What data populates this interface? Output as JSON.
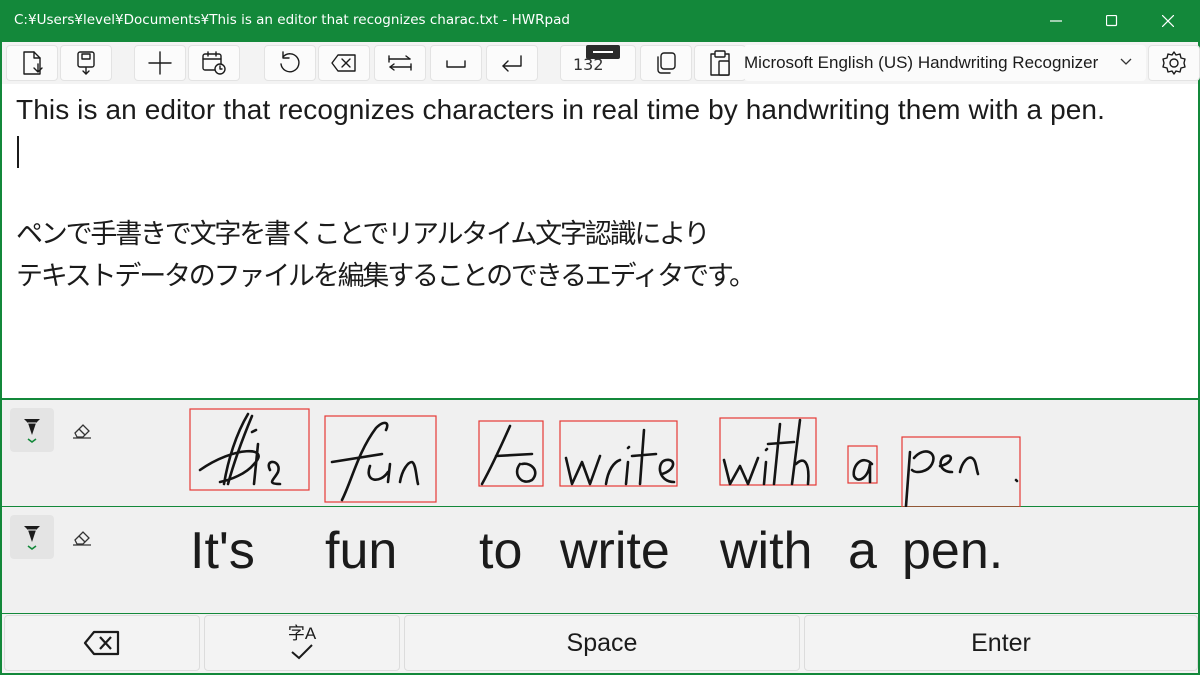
{
  "window": {
    "title": "C:¥Users¥level¥Documents¥This is an editor that recognizes charac.txt - HWRpad",
    "accent_color": "#13883a"
  },
  "toolbar": {
    "buttons": [
      {
        "name": "new-file",
        "icon": "new-file-icon"
      },
      {
        "name": "save",
        "icon": "save-icon"
      },
      {
        "name": "add",
        "icon": "plus-icon"
      },
      {
        "name": "insert-date",
        "icon": "calendar-clock-icon"
      },
      {
        "name": "undo",
        "icon": "undo-icon"
      },
      {
        "name": "delete",
        "icon": "backspace-icon"
      },
      {
        "name": "tab",
        "icon": "tab-icon"
      },
      {
        "name": "space",
        "icon": "space-icon"
      },
      {
        "name": "enter",
        "icon": "enter-icon"
      },
      {
        "name": "copy",
        "icon": "copy-icon"
      },
      {
        "name": "paste",
        "icon": "paste-icon"
      },
      {
        "name": "settings",
        "icon": "gear-icon"
      }
    ],
    "char_count": "132",
    "recognizer": "Microsoft English (US) Handwriting Recognizer"
  },
  "editor": {
    "lines": [
      "This is an editor that recognizes characters in real time by handwriting them with a pen.",
      "",
      "",
      "ペンで手書きで文字を書くことでリアルタイム文字認識により",
      "テキストデータのファイルを編集することのできるエディタです。"
    ]
  },
  "ink_panel": {
    "box_color": "#e53935",
    "tools": {
      "pen": "pen-icon",
      "eraser": "eraser-icon"
    }
  },
  "recognized": {
    "words": [
      "It's",
      "fun",
      "to",
      "write",
      "with",
      "a",
      "pen."
    ]
  },
  "bottom_bar": {
    "backspace_icon": "backspace-icon",
    "convert_label": "字A",
    "space_label": "Space",
    "enter_label": "Enter"
  }
}
